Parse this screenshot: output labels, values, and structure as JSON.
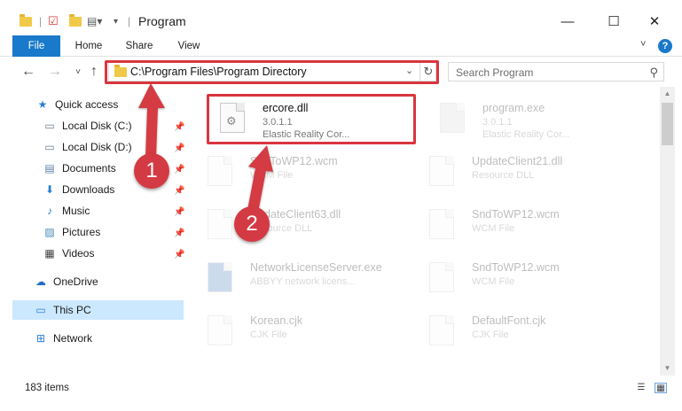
{
  "window": {
    "title": "Program",
    "minimize": "—",
    "maximize": "☐",
    "close": "✕"
  },
  "ribbon": {
    "tabs": [
      "File",
      "Home",
      "Share",
      "View"
    ],
    "help": "?"
  },
  "address": {
    "path": "C:\\Program Files\\Program Directory",
    "search_placeholder": "Search Program"
  },
  "nav": {
    "items": [
      {
        "label": "Quick access",
        "icon": "star-icon",
        "pinned": false
      },
      {
        "label": "Local Disk (C:)",
        "icon": "drive-icon",
        "pinned": true
      },
      {
        "label": "Local Disk (D:)",
        "icon": "drive-icon",
        "pinned": true
      },
      {
        "label": "Documents",
        "icon": "documents-icon",
        "pinned": true
      },
      {
        "label": "Downloads",
        "icon": "download-icon",
        "pinned": true
      },
      {
        "label": "Music",
        "icon": "music-icon",
        "pinned": true
      },
      {
        "label": "Pictures",
        "icon": "pictures-icon",
        "pinned": true
      },
      {
        "label": "Videos",
        "icon": "videos-icon",
        "pinned": true
      },
      {
        "label": "OneDrive",
        "icon": "cloud-icon",
        "pinned": false
      },
      {
        "label": "This PC",
        "icon": "computer-icon",
        "pinned": false
      },
      {
        "label": "Network",
        "icon": "network-icon",
        "pinned": false
      }
    ]
  },
  "files": [
    {
      "name": "ercore.dll",
      "line2": "3.0.1.1",
      "line3": "Elastic Reality Cor...",
      "highlighted": true
    },
    {
      "name": "program.exe",
      "line2": "3.0.1.1",
      "line3": "Elastic Reality Cor...",
      "highlighted": false
    },
    {
      "name": "SndToWP12.wcm",
      "line2": "WCM File",
      "line3": "",
      "highlighted": false
    },
    {
      "name": "UpdateClient21.dll",
      "line2": "Resource DLL",
      "line3": "",
      "highlighted": false
    },
    {
      "name": "UpdateClient63.dll",
      "line2": "Resource DLL",
      "line3": "",
      "highlighted": false
    },
    {
      "name": "SndToWP12.wcm",
      "line2": "WCM File",
      "line3": "",
      "highlighted": false
    },
    {
      "name": "NetworkLicenseServer.exe",
      "line2": "ABBYY network licens...",
      "line3": "",
      "highlighted": false
    },
    {
      "name": "SndToWP12.wcm",
      "line2": "WCM File",
      "line3": "",
      "highlighted": false
    },
    {
      "name": "Korean.cjk",
      "line2": "CJK File",
      "line3": "",
      "highlighted": false
    },
    {
      "name": "DefaultFont.cjk",
      "line2": "CJK File",
      "line3": "",
      "highlighted": false
    }
  ],
  "status": {
    "item_count": "183 items"
  },
  "callouts": [
    "1",
    "2"
  ],
  "colors": {
    "accent": "#1979ca",
    "highlight": "#d9353f",
    "selected": "#cce8ff"
  }
}
